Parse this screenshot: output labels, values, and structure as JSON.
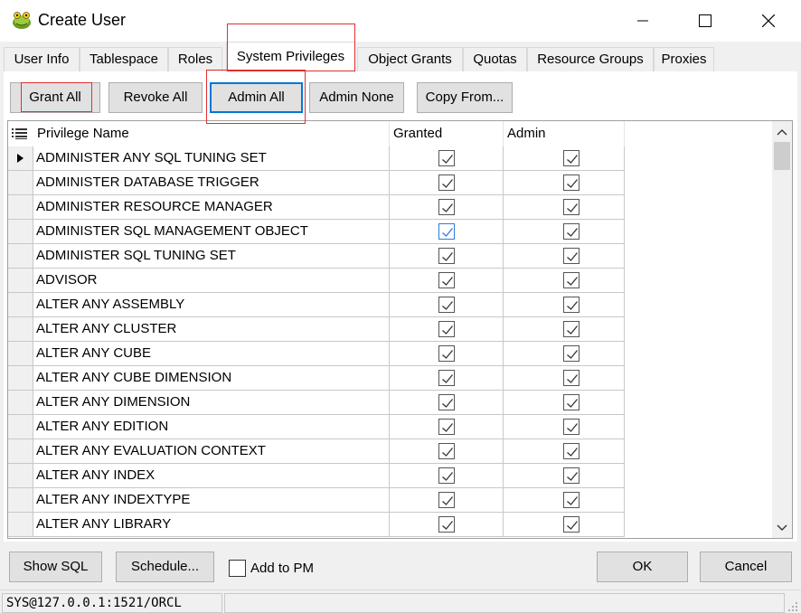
{
  "window": {
    "title": "Create User",
    "icon": "toad-app-icon"
  },
  "tabs": [
    {
      "label": "User Info"
    },
    {
      "label": "Tablespace"
    },
    {
      "label": "Roles"
    },
    {
      "label": "System Privileges",
      "active": true
    },
    {
      "label": "Object Grants"
    },
    {
      "label": "Quotas"
    },
    {
      "label": "Resource Groups"
    },
    {
      "label": "Proxies"
    }
  ],
  "toolbar": {
    "grant_all": "Grant All",
    "revoke_all": "Revoke All",
    "admin_all": "Admin All",
    "admin_none": "Admin None",
    "copy_from": "Copy From..."
  },
  "grid": {
    "columns": {
      "name": "Privilege Name",
      "granted": "Granted",
      "admin": "Admin"
    },
    "rows": [
      {
        "name": "ADMINISTER ANY SQL TUNING SET",
        "granted": true,
        "admin": true,
        "current": true
      },
      {
        "name": "ADMINISTER DATABASE TRIGGER",
        "granted": true,
        "admin": true
      },
      {
        "name": "ADMINISTER RESOURCE MANAGER",
        "granted": true,
        "admin": true
      },
      {
        "name": "ADMINISTER SQL MANAGEMENT OBJECT",
        "granted": true,
        "admin": true,
        "focused": true
      },
      {
        "name": "ADMINISTER SQL TUNING SET",
        "granted": true,
        "admin": true
      },
      {
        "name": "ADVISOR",
        "granted": true,
        "admin": true
      },
      {
        "name": "ALTER ANY ASSEMBLY",
        "granted": true,
        "admin": true
      },
      {
        "name": "ALTER ANY CLUSTER",
        "granted": true,
        "admin": true
      },
      {
        "name": "ALTER ANY CUBE",
        "granted": true,
        "admin": true
      },
      {
        "name": "ALTER ANY CUBE DIMENSION",
        "granted": true,
        "admin": true
      },
      {
        "name": "ALTER ANY DIMENSION",
        "granted": true,
        "admin": true
      },
      {
        "name": "ALTER ANY EDITION",
        "granted": true,
        "admin": true
      },
      {
        "name": "ALTER ANY EVALUATION CONTEXT",
        "granted": true,
        "admin": true
      },
      {
        "name": "ALTER ANY INDEX",
        "granted": true,
        "admin": true
      },
      {
        "name": "ALTER ANY INDEXTYPE",
        "granted": true,
        "admin": true
      },
      {
        "name": "ALTER ANY LIBRARY",
        "granted": true,
        "admin": true
      }
    ]
  },
  "footer": {
    "show_sql": "Show SQL",
    "schedule": "Schedule...",
    "add_to_pm": "Add to PM",
    "add_to_pm_checked": false,
    "ok": "OK",
    "cancel": "Cancel"
  },
  "status": {
    "connection": "SYS@127.0.0.1:1521/ORCL"
  },
  "colors": {
    "highlight_box": "#e0302e",
    "focus_blue": "#0078d7",
    "check_blue": "#2b7de0"
  }
}
